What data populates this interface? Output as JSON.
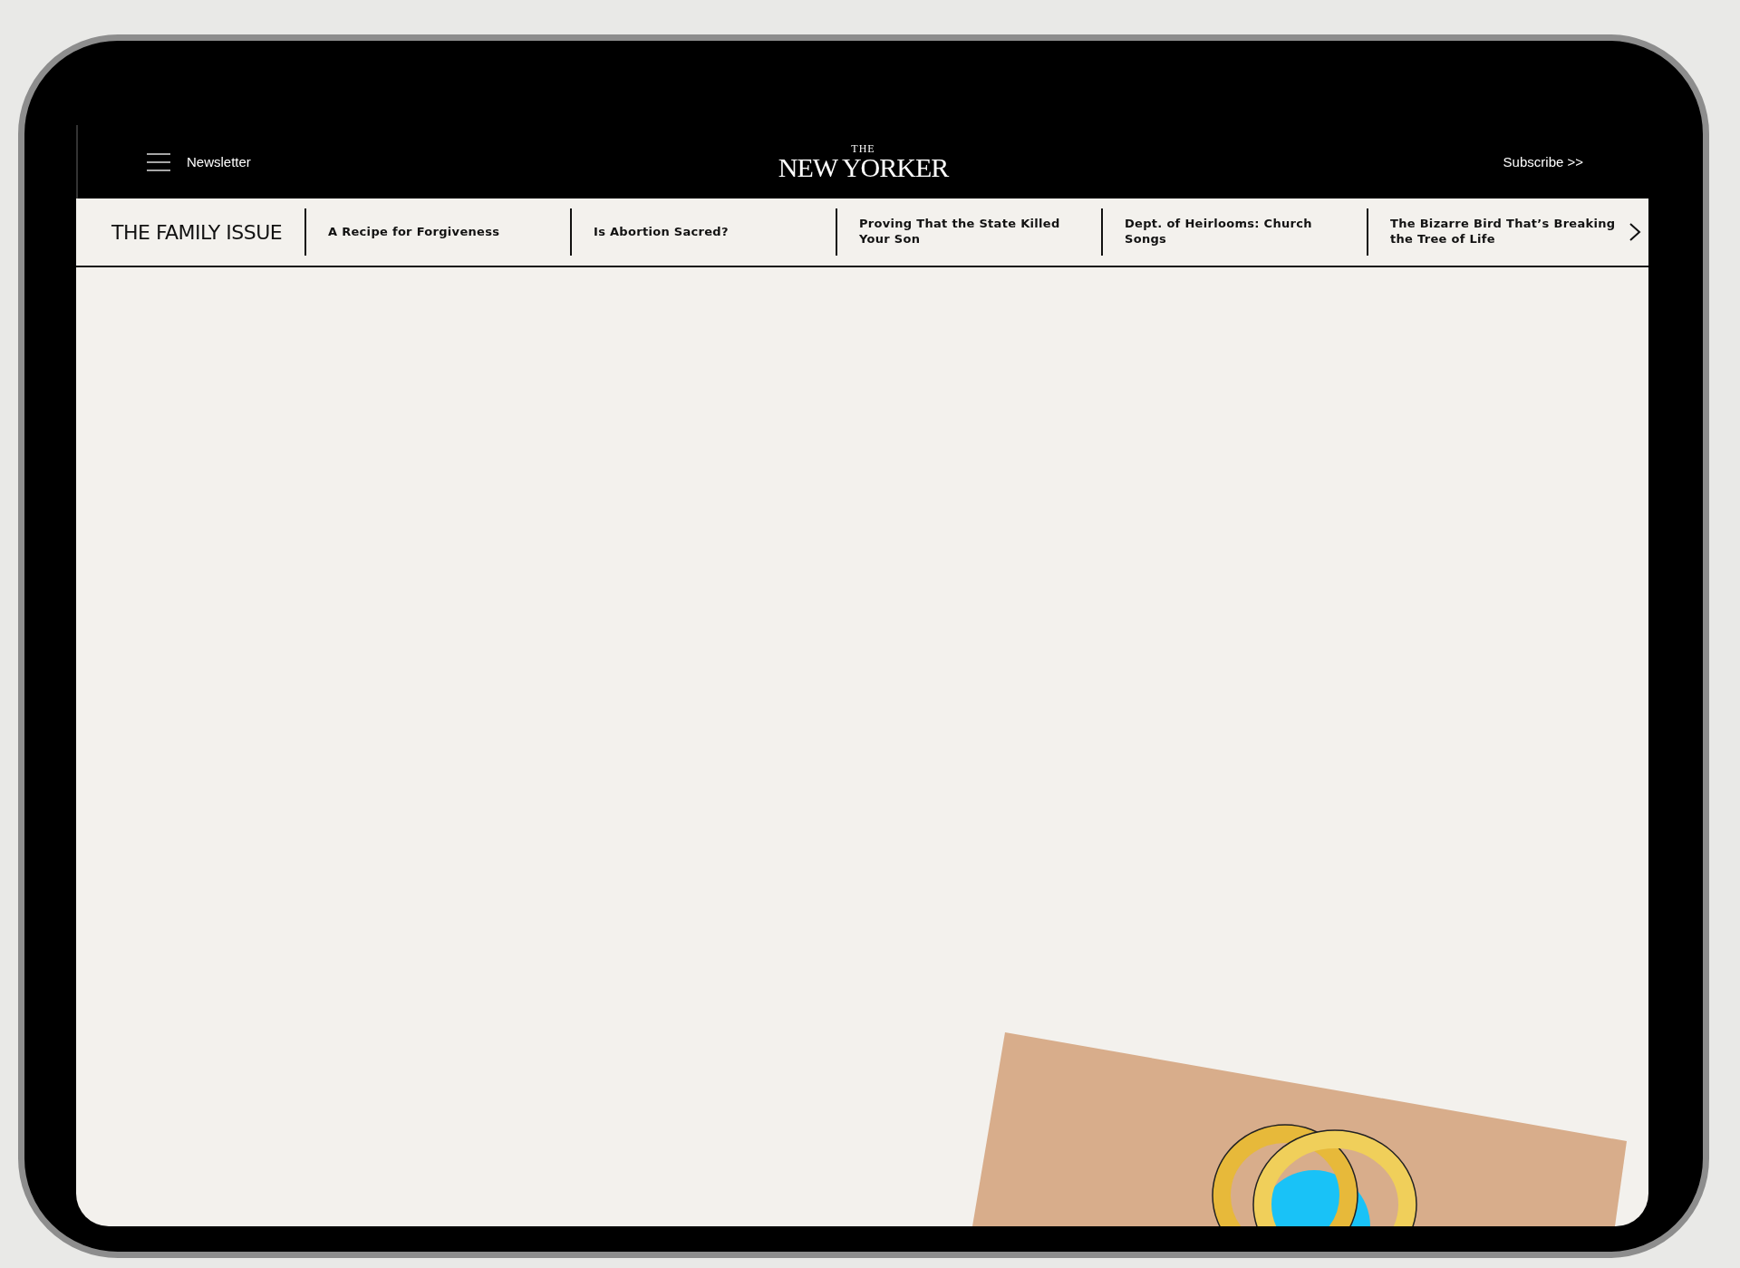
{
  "header": {
    "newsletter": "Newsletter",
    "logo_small": "THE",
    "logo": "NEW YORKER",
    "subscribe": "Subscribe >>"
  },
  "nav": {
    "title": "THE FAMILY ISSUE",
    "items": [
      {
        "label": "A Recipe for Forgiveness"
      },
      {
        "label": "Is Abortion Sacred?"
      },
      {
        "label": "Proving That the State Killed Your Son"
      },
      {
        "label": "Dept. of Heirlooms: Church Songs"
      },
      {
        "label": "The Bizarre Bird That’s Breaking the Tree of Life"
      }
    ]
  }
}
